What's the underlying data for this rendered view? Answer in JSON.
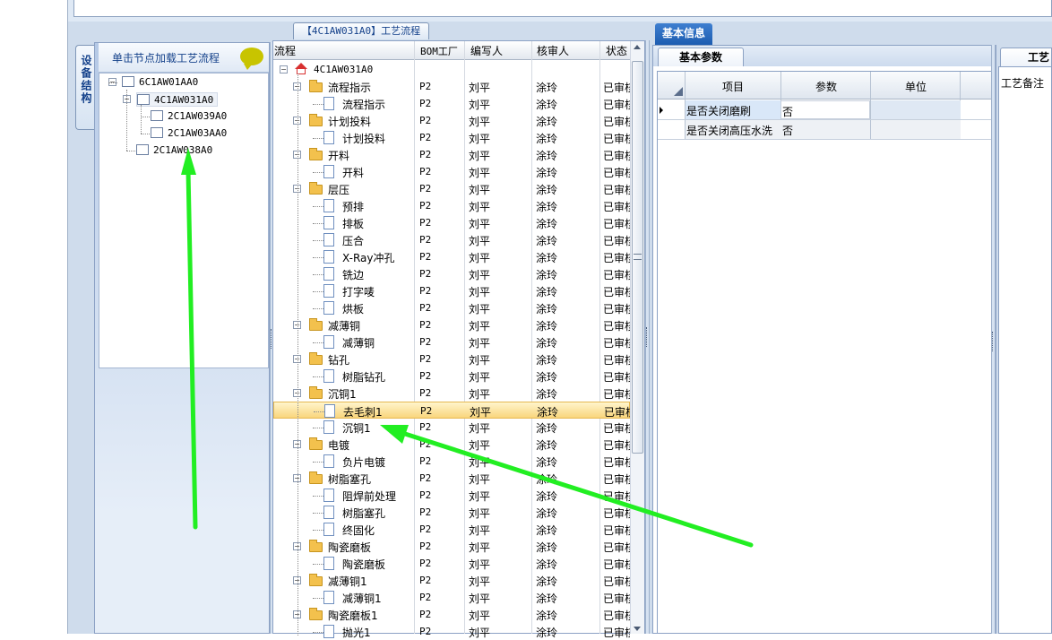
{
  "left_panel": {
    "side_tab": "设备结构",
    "header": "单击节点加载工艺流程",
    "tree": [
      {
        "label": "6C1AW01AA0",
        "level": 0,
        "expanded": true
      },
      {
        "label": "4C1AW031A0",
        "level": 1,
        "expanded": true,
        "selected": true
      },
      {
        "label": "2C1AW039A0",
        "level": 2
      },
      {
        "label": "2C1AW03AA0",
        "level": 2
      },
      {
        "label": "2C1AW038A0",
        "level": 1
      }
    ]
  },
  "center_panel": {
    "tab": "【4C1AW031A0】工艺流程",
    "columns": [
      "流程",
      "BOM工厂",
      "编写人",
      "核审人",
      "状态"
    ],
    "root": "4C1AW031A0",
    "rows": [
      {
        "name": "流程指示",
        "type": "folder",
        "bom": "P2",
        "writer": "刘平",
        "reviewer": "涂玲",
        "status": "已审核"
      },
      {
        "name": "流程指示",
        "type": "doc",
        "bom": "P2",
        "writer": "刘平",
        "reviewer": "涂玲",
        "status": "已审核"
      },
      {
        "name": "计划投料",
        "type": "folder",
        "bom": "P2",
        "writer": "刘平",
        "reviewer": "涂玲",
        "status": "已审核"
      },
      {
        "name": "计划投料",
        "type": "doc",
        "bom": "P2",
        "writer": "刘平",
        "reviewer": "涂玲",
        "status": "已审核"
      },
      {
        "name": "开料",
        "type": "folder",
        "bom": "P2",
        "writer": "刘平",
        "reviewer": "涂玲",
        "status": "已审核"
      },
      {
        "name": "开料",
        "type": "doc",
        "bom": "P2",
        "writer": "刘平",
        "reviewer": "涂玲",
        "status": "已审核"
      },
      {
        "name": "层压",
        "type": "folder",
        "bom": "P2",
        "writer": "刘平",
        "reviewer": "涂玲",
        "status": "已审核"
      },
      {
        "name": "预排",
        "type": "doc",
        "bom": "P2",
        "writer": "刘平",
        "reviewer": "涂玲",
        "status": "已审核"
      },
      {
        "name": "排板",
        "type": "doc",
        "bom": "P2",
        "writer": "刘平",
        "reviewer": "涂玲",
        "status": "已审核"
      },
      {
        "name": "压合",
        "type": "doc",
        "bom": "P2",
        "writer": "刘平",
        "reviewer": "涂玲",
        "status": "已审核"
      },
      {
        "name": "X-Ray冲孔",
        "type": "doc",
        "bom": "P2",
        "writer": "刘平",
        "reviewer": "涂玲",
        "status": "已审核"
      },
      {
        "name": "铣边",
        "type": "doc",
        "bom": "P2",
        "writer": "刘平",
        "reviewer": "涂玲",
        "status": "已审核"
      },
      {
        "name": "打字唛",
        "type": "doc",
        "bom": "P2",
        "writer": "刘平",
        "reviewer": "涂玲",
        "status": "已审核"
      },
      {
        "name": "烘板",
        "type": "doc",
        "bom": "P2",
        "writer": "刘平",
        "reviewer": "涂玲",
        "status": "已审核"
      },
      {
        "name": "减薄铜",
        "type": "folder",
        "bom": "P2",
        "writer": "刘平",
        "reviewer": "涂玲",
        "status": "已审核"
      },
      {
        "name": "减薄铜",
        "type": "doc",
        "bom": "P2",
        "writer": "刘平",
        "reviewer": "涂玲",
        "status": "已审核"
      },
      {
        "name": "钻孔",
        "type": "folder",
        "bom": "P2",
        "writer": "刘平",
        "reviewer": "涂玲",
        "status": "已审核"
      },
      {
        "name": "树脂钻孔",
        "type": "doc",
        "bom": "P2",
        "writer": "刘平",
        "reviewer": "涂玲",
        "status": "已审核"
      },
      {
        "name": "沉铜1",
        "type": "folder",
        "bom": "P2",
        "writer": "刘平",
        "reviewer": "涂玲",
        "status": "已审核"
      },
      {
        "name": "去毛刺1",
        "type": "doc",
        "bom": "P2",
        "writer": "刘平",
        "reviewer": "涂玲",
        "status": "已审核",
        "selected": true
      },
      {
        "name": "沉铜1",
        "type": "doc",
        "bom": "P2",
        "writer": "刘平",
        "reviewer": "涂玲",
        "status": "已审核"
      },
      {
        "name": "电镀",
        "type": "folder",
        "bom": "P2",
        "writer": "刘平",
        "reviewer": "涂玲",
        "status": "已审核"
      },
      {
        "name": "负片电镀",
        "type": "doc",
        "bom": "P2",
        "writer": "刘平",
        "reviewer": "涂玲",
        "status": "已审核"
      },
      {
        "name": "树脂塞孔",
        "type": "folder",
        "bom": "P2",
        "writer": "刘平",
        "reviewer": "涂玲",
        "status": "已审核"
      },
      {
        "name": "阻焊前处理",
        "type": "doc",
        "bom": "P2",
        "writer": "刘平",
        "reviewer": "涂玲",
        "status": "已审核"
      },
      {
        "name": "树脂塞孔",
        "type": "doc",
        "bom": "P2",
        "writer": "刘平",
        "reviewer": "涂玲",
        "status": "已审核"
      },
      {
        "name": "终固化",
        "type": "doc",
        "bom": "P2",
        "writer": "刘平",
        "reviewer": "涂玲",
        "status": "已审核"
      },
      {
        "name": "陶瓷磨板",
        "type": "folder",
        "bom": "P2",
        "writer": "刘平",
        "reviewer": "涂玲",
        "status": "已审核"
      },
      {
        "name": "陶瓷磨板",
        "type": "doc",
        "bom": "P2",
        "writer": "刘平",
        "reviewer": "涂玲",
        "status": "已审核"
      },
      {
        "name": "减薄铜1",
        "type": "folder",
        "bom": "P2",
        "writer": "刘平",
        "reviewer": "涂玲",
        "status": "已审核"
      },
      {
        "name": "减薄铜1",
        "type": "doc",
        "bom": "P2",
        "writer": "刘平",
        "reviewer": "涂玲",
        "status": "已审核"
      },
      {
        "name": "陶瓷磨板1",
        "type": "folder",
        "bom": "P2",
        "writer": "刘平",
        "reviewer": "涂玲",
        "status": "已审核"
      },
      {
        "name": "抛光1",
        "type": "doc",
        "bom": "P2",
        "writer": "刘平",
        "reviewer": "涂玲",
        "status": "已审核"
      }
    ]
  },
  "right_panel": {
    "tab": "基本信息",
    "subtab": "基本参数",
    "columns": [
      "项目",
      "参数",
      "单位"
    ],
    "rows": [
      {
        "item": "是否关闭磨刷",
        "param": "否",
        "unit": ""
      },
      {
        "item": "是否关闭高压水洗",
        "param": "否",
        "unit": ""
      }
    ]
  },
  "far_panel": {
    "tab": "工艺",
    "label": "工艺备注"
  },
  "annotation_color": "#22ee22"
}
